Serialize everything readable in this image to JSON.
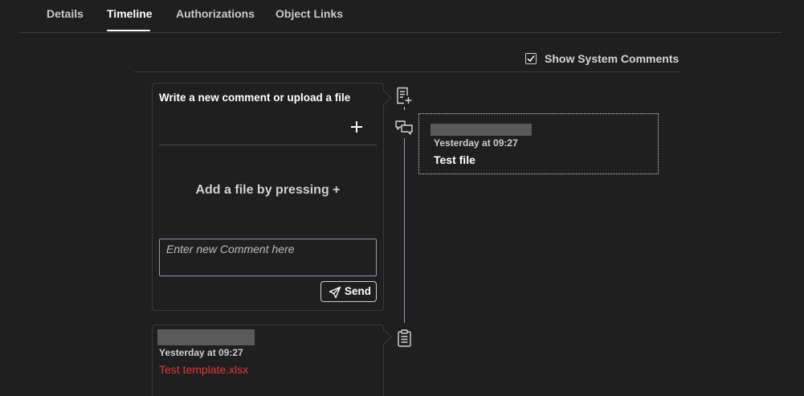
{
  "tabs": [
    {
      "label": "Details",
      "active": false
    },
    {
      "label": "Timeline",
      "active": true
    },
    {
      "label": "Authorizations",
      "active": false
    },
    {
      "label": "Object Links",
      "active": false
    }
  ],
  "filters": {
    "show_system_comments_label": "Show System Comments",
    "show_system_comments_checked": true
  },
  "composer": {
    "title": "Write a new comment or upload a file",
    "add_icon": "plus-icon",
    "drop_hint": "Add a file by pressing +",
    "comment_placeholder": "Enter new Comment here",
    "comment_value": "",
    "send_label": "Send",
    "send_icon": "paper-plane-icon"
  },
  "timeline": {
    "icons": [
      "new-document-icon",
      "comments-icon",
      "clipboard-icon"
    ],
    "line_color": "#8f9aa8"
  },
  "entries": [
    {
      "time": "Yesterday at 09:27",
      "text": "Test file",
      "type": "comment"
    },
    {
      "time": "Yesterday at 09:27",
      "text": "Test template.xlsx",
      "type": "file",
      "link_color": "#d9393b"
    }
  ]
}
